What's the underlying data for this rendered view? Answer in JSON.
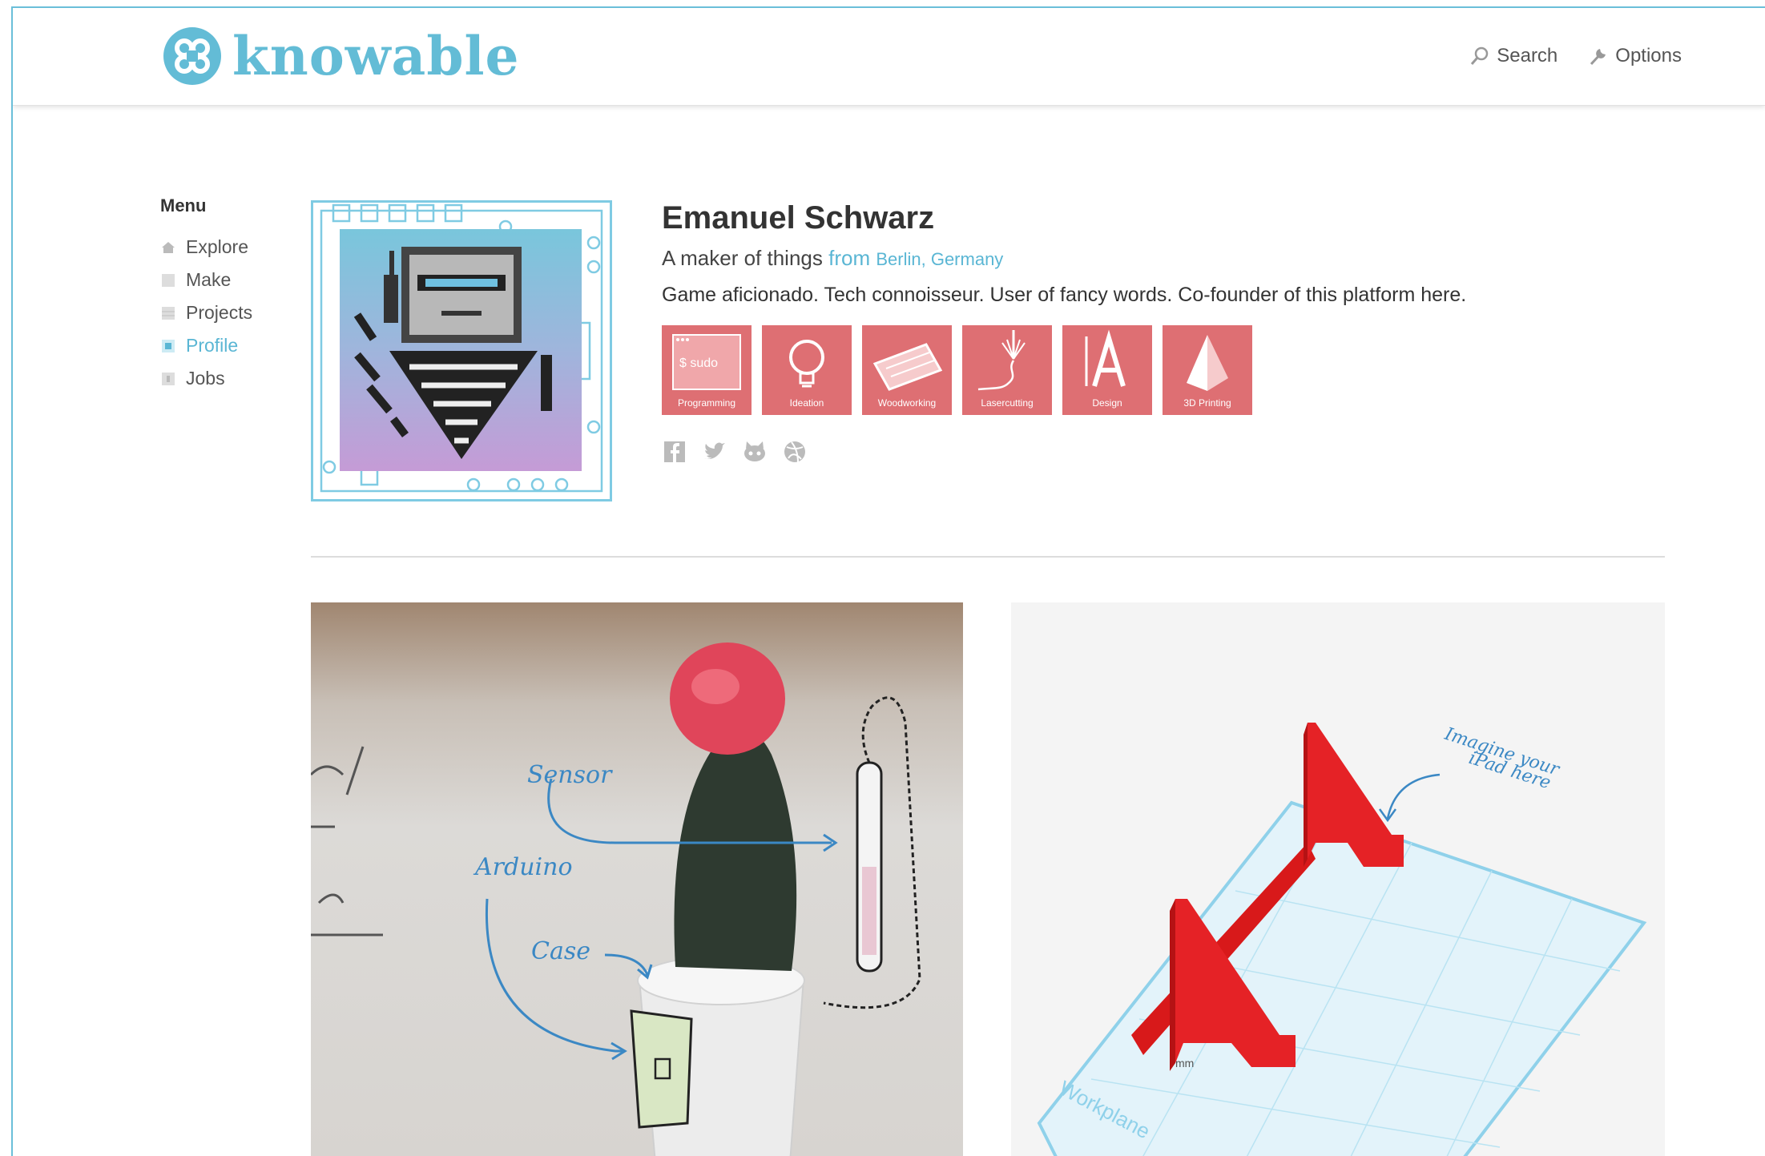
{
  "brand": {
    "name": "knowable",
    "accent": "#63bcd6"
  },
  "header": {
    "search_label": "Search",
    "options_label": "Options"
  },
  "menu": {
    "title": "Menu",
    "items": [
      {
        "label": "Explore",
        "icon": "home-icon",
        "active": false
      },
      {
        "label": "Make",
        "icon": "square-icon",
        "active": false
      },
      {
        "label": "Projects",
        "icon": "grid-icon",
        "active": false
      },
      {
        "label": "Profile",
        "icon": "profile-icon",
        "active": true
      },
      {
        "label": "Jobs",
        "icon": "jobs-icon",
        "active": false
      }
    ]
  },
  "profile": {
    "name": "Emanuel Schwarz",
    "tagline": "A maker of things",
    "from": "from",
    "location": "Berlin, Germany",
    "bio": "Game aficionado. Tech connoisseur. User of fancy words. Co-founder of this platform here.",
    "skills": [
      {
        "label": "Programming",
        "icon": "terminal-icon"
      },
      {
        "label": "Ideation",
        "icon": "lightbulb-icon"
      },
      {
        "label": "Woodworking",
        "icon": "plank-icon"
      },
      {
        "label": "Lasercutting",
        "icon": "laser-icon"
      },
      {
        "label": "Design",
        "icon": "type-icon"
      },
      {
        "label": "3D Printing",
        "icon": "prism-icon"
      }
    ],
    "skill_color": "#de6f73",
    "social": [
      "facebook-icon",
      "twitter-icon",
      "github-icon",
      "dribbble-icon"
    ]
  },
  "projects": {
    "left_annotations": {
      "sensor": "Sensor",
      "arduino": "Arduino",
      "case": "Case"
    },
    "right_annotations": {
      "imagine": "Imagine your",
      "ipad": "iPad here",
      "workplane": "Workplane",
      "unit": "mm"
    }
  }
}
